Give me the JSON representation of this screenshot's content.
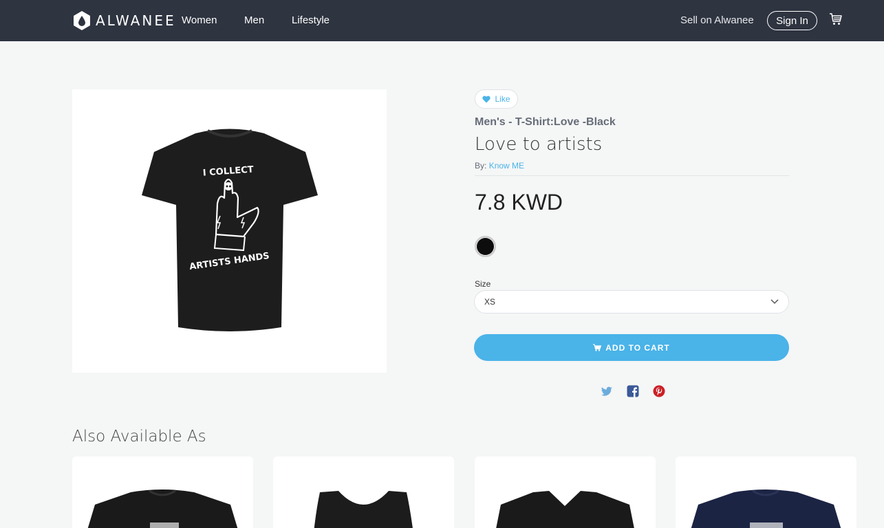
{
  "nav": {
    "logo_text": "ALWANEE",
    "links": [
      "Women",
      "Men",
      "Lifestyle"
    ],
    "sell_label": "Sell on Alwanee",
    "signin_label": "Sign In",
    "cart_icon": "shopping-cart-icon"
  },
  "product": {
    "like_label": "Like",
    "subtitle": "Men's - T-Shirt:Love -Black",
    "title": "Love to artists",
    "by_prefix": "By:",
    "author": "Know ME",
    "price": "7.8 KWD",
    "color_selected": "#0d0d0d",
    "print_text_top": "I COLLECT",
    "print_text_bottom": "ARTISTS HANDS",
    "size_label": "Size",
    "size_value": "XS",
    "add_to_cart_label": "ADD TO CART"
  },
  "share": {
    "icons": [
      "twitter-icon",
      "facebook-icon",
      "pinterest-icon"
    ]
  },
  "also": {
    "title": "Also Available As",
    "cards": [
      {
        "name": "black t-shirt",
        "color": "#1a1a1a"
      },
      {
        "name": "black tank top",
        "color": "#1c1c1c"
      },
      {
        "name": "black v-neck",
        "color": "#1a1a1a"
      },
      {
        "name": "navy t-shirt",
        "color": "#1c2444"
      }
    ]
  },
  "colors": {
    "nav_bg": "#2e3440",
    "accent": "#4ab3e8",
    "page_bg": "#f5f6f6"
  }
}
